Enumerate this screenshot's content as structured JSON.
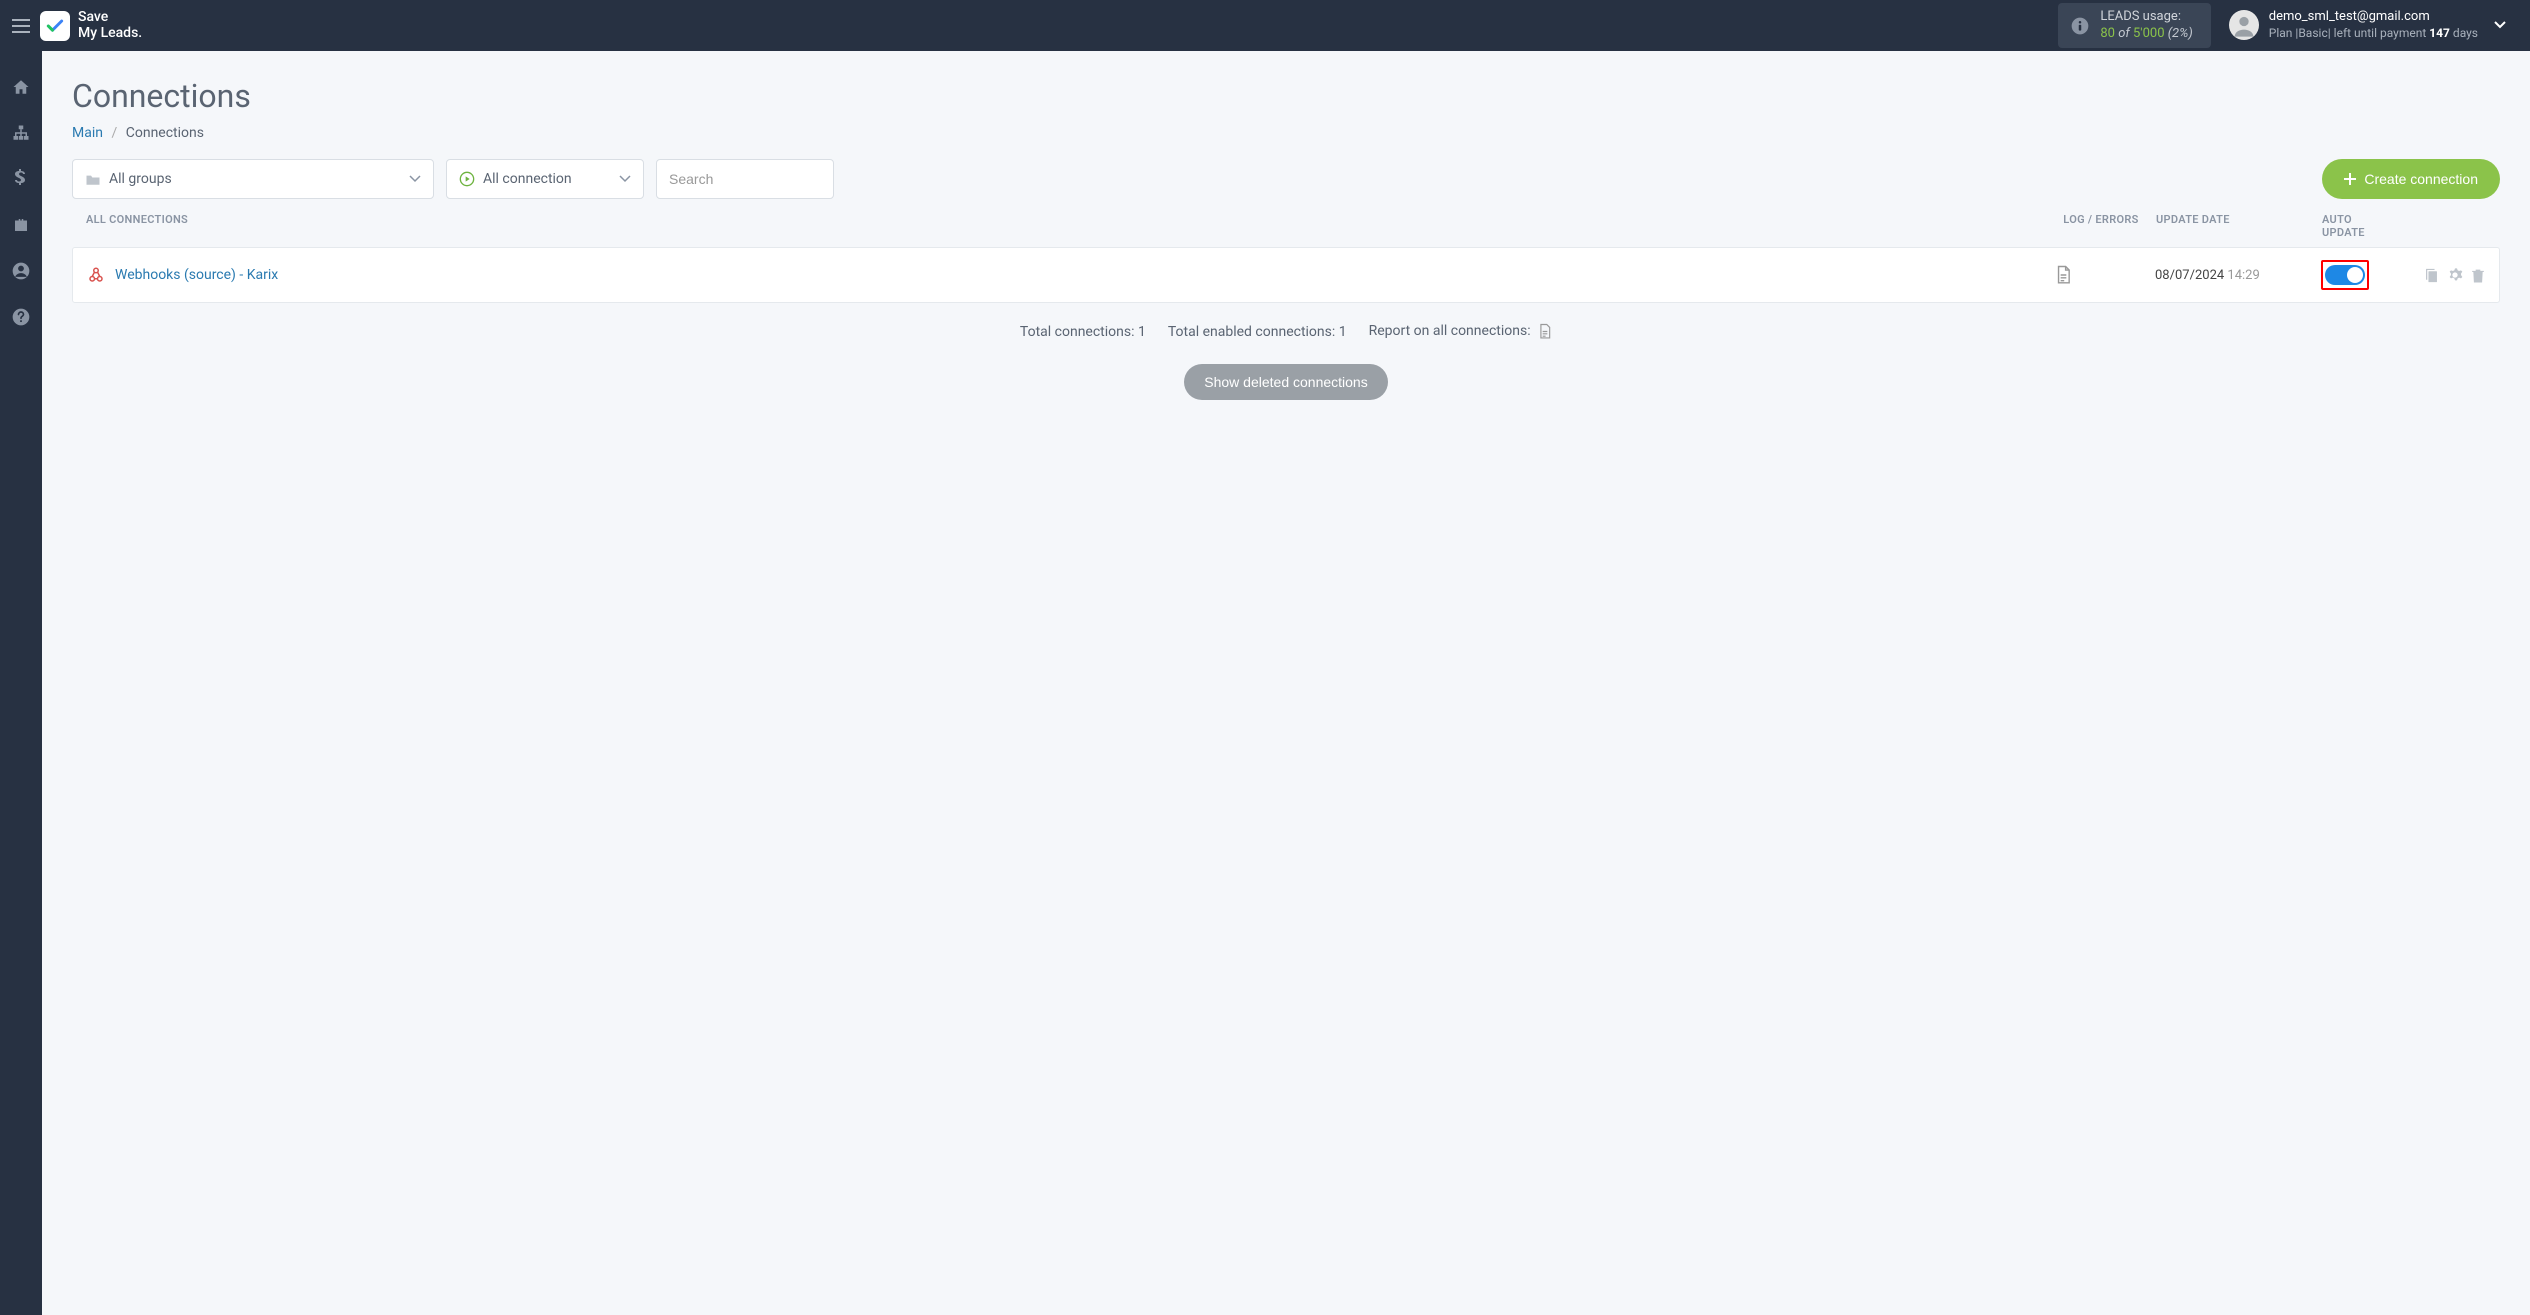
{
  "header": {
    "logo_line1": "Save",
    "logo_line2": "My Leads.",
    "leads_label": "LEADS usage:",
    "leads_used": "80",
    "leads_of": "of",
    "leads_total": "5'000",
    "leads_pct": "(2%)",
    "user_email": "demo_sml_test@gmail.com",
    "plan_prefix": "Plan |",
    "plan_name": "Basic",
    "plan_sep": "|",
    "plan_suffix1": "left until payment",
    "plan_days": "147",
    "plan_suffix2": "days"
  },
  "page": {
    "title": "Connections",
    "breadcrumb_main": "Main",
    "breadcrumb_current": "Connections"
  },
  "filters": {
    "groups_label": "All groups",
    "conn_label": "All connection",
    "search_placeholder": "Search",
    "create_btn": "Create connection"
  },
  "table": {
    "col_name": "ALL CONNECTIONS",
    "col_log": "LOG / ERRORS",
    "col_date": "UPDATE DATE",
    "col_auto": "AUTO UPDATE",
    "rows": [
      {
        "name": "Webhooks (source) - Karix",
        "date": "08/07/2024",
        "time": "14:29",
        "auto_update": true
      }
    ]
  },
  "summary": {
    "total_label": "Total connections:",
    "total_value": "1",
    "enabled_label": "Total enabled connections:",
    "enabled_value": "1",
    "report_label": "Report on all connections:"
  },
  "show_deleted": "Show deleted connections"
}
